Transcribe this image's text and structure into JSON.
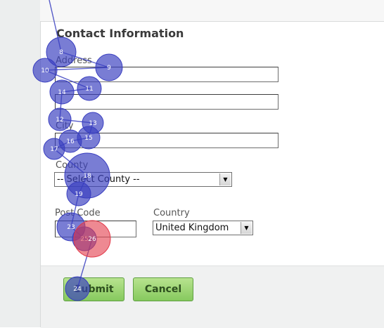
{
  "form": {
    "title": "Contact Information",
    "address_label": "Address",
    "city_label": "City",
    "county_label": "County",
    "county_selected": "-- Select County --",
    "postcode_label": "Post Code",
    "country_label": "Country",
    "country_selected": "United Kingdom",
    "submit_label": "Submit",
    "cancel_label": "Cancel"
  },
  "gaze_overlay": {
    "colors": {
      "fixation": "#3a3fc0",
      "highlight": "#e23a4a",
      "path": "#3a3fc0"
    },
    "fixations": [
      {
        "label": "8"
      },
      {
        "label": "9"
      },
      {
        "label": "10"
      },
      {
        "label": "11"
      },
      {
        "label": "14"
      },
      {
        "label": "12"
      },
      {
        "label": "13"
      },
      {
        "label": "15"
      },
      {
        "label": "16"
      },
      {
        "label": "17"
      },
      {
        "label": "18"
      },
      {
        "label": "19"
      },
      {
        "label": "23"
      },
      {
        "label": "25"
      },
      {
        "label": "26"
      },
      {
        "label": "24"
      }
    ]
  }
}
